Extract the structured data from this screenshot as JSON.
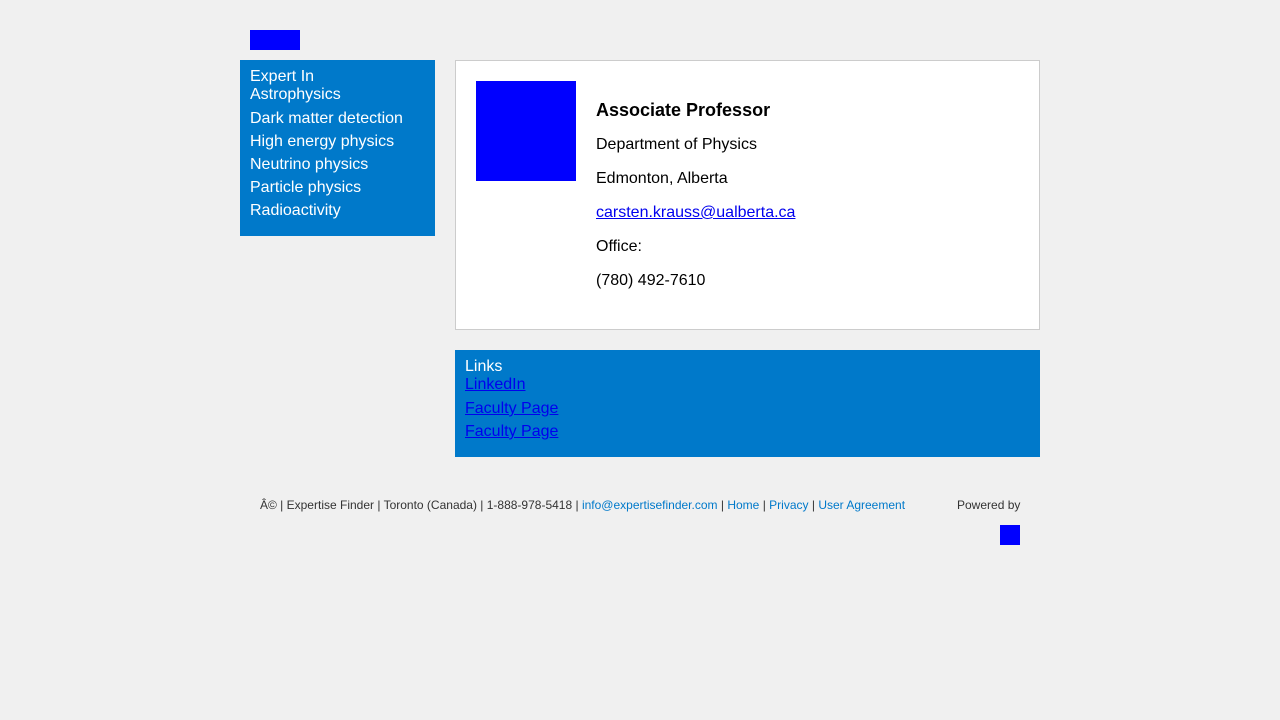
{
  "colors": {
    "background": "#f0f0f0",
    "panel_blue": "#0079ca",
    "placeholder_blue": "#0000ff",
    "link": "#0000ee"
  },
  "logo": {
    "icon": "logo-placeholder"
  },
  "expert_in": {
    "heading": "Expert In",
    "items": [
      "Astrophysics",
      "Dark matter detection",
      "High energy physics",
      "Neutrino physics",
      "Particle physics",
      "Radioactivity"
    ]
  },
  "profile": {
    "photo_icon": "profile-photo-placeholder",
    "title": "Associate Professor",
    "department": "Department of Physics",
    "location": "Edmonton, Alberta",
    "email": "carsten.krauss@ualberta.ca",
    "office_label": "Office:",
    "phone": "(780) 492-7610"
  },
  "links": {
    "heading": "Links",
    "items": [
      "LinkedIn",
      "Faculty Page",
      "Faculty Page"
    ]
  },
  "footer": {
    "copyright": "Â© | Expertise Finder | Toronto (Canada) | 1-888-978-5418 |",
    "email": "info@expertisefinder.com",
    "sep1": "|",
    "home": "Home",
    "sep2": "|",
    "privacy": "Privacy",
    "sep3": "|",
    "agreement": "User Agreement",
    "powered_by": "Powered by",
    "powered_logo_icon": "powered-by-logo"
  }
}
